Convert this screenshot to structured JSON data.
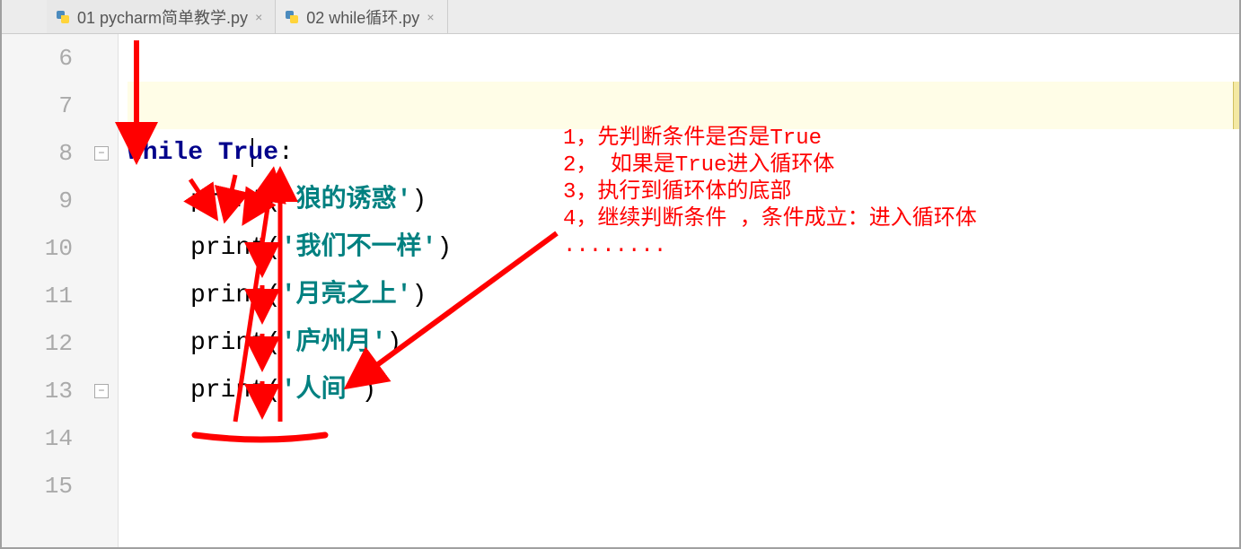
{
  "tabs": [
    {
      "label": "01 pycharm简单教学.py",
      "active": true
    },
    {
      "label": "02 while循环.py",
      "active": false
    }
  ],
  "gutter": {
    "start": 6,
    "end": 15,
    "fold_minus_lines": [
      8,
      13
    ]
  },
  "code": {
    "keyword_while": "while",
    "keyword_true": "True",
    "colon": ":",
    "fn_print": "print",
    "open_paren": "(",
    "close_paren": ")",
    "str_open": "'",
    "str_close": "'",
    "strings": {
      "line9": "狼的诱惑",
      "line10": "我们不一样",
      "line11": "月亮之上",
      "line12": "庐州月",
      "line13": "人间"
    }
  },
  "annotations": {
    "line1": "1，先判断条件是否是True",
    "line2": "2， 如果是True进入循环体",
    "line3": "3，执行到循环体的底部",
    "line4": "4，继续判断条件 ，条件成立：进入循环体",
    "line5": "........"
  },
  "close_glyph": "×"
}
